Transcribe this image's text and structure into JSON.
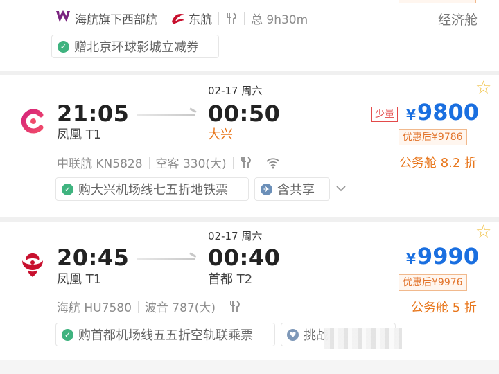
{
  "top": {
    "airline": "海航旗下西部航",
    "partner": "东航",
    "duration": "总 9h30m",
    "cabin": "经济舱",
    "coupon": "赠北京环球影城立减券"
  },
  "flights": [
    {
      "dep_time": "21:05",
      "dep_airport": "凤凰 T1",
      "arr_date": "02-17 周六",
      "arr_time": "00:50",
      "arr_airport": "大兴",
      "airline_info": "中联航 KN5828",
      "aircraft": "空客 330(大)",
      "scarcity": "少量",
      "currency": "¥",
      "price": "9800",
      "discount_price": "优惠后¥9786",
      "cabin": "公务舱 8.2 折",
      "tags": [
        "购大兴机场线七五折地铁票",
        "含共享"
      ]
    },
    {
      "dep_time": "20:45",
      "dep_airport": "凤凰 T1",
      "arr_date": "02-17 周六",
      "arr_time": "00:40",
      "arr_airport": "首都 T2",
      "airline_info": "海航 HU7580",
      "aircraft": "波音 787(大)",
      "currency": "¥",
      "price": "9990",
      "discount_price": "优惠后¥9976",
      "cabin": "公务舱 5 折",
      "tags": [
        "购首都机场线五五折空轨联乘票",
        "挑战"
      ]
    }
  ],
  "colors": {
    "price": "#1a6fe0",
    "accent": "#e8771d",
    "check": "#3fb37f",
    "star": "#f0c040"
  },
  "icons": [
    "west-air-logo-icon",
    "china-eastern-logo-icon",
    "meal-icon",
    "check-icon",
    "united-airlines-logo-icon",
    "wifi-icon",
    "plane-icon",
    "chevron-down-icon",
    "hainan-airlines-logo-icon",
    "heart-badge-icon",
    "star-icon"
  ]
}
